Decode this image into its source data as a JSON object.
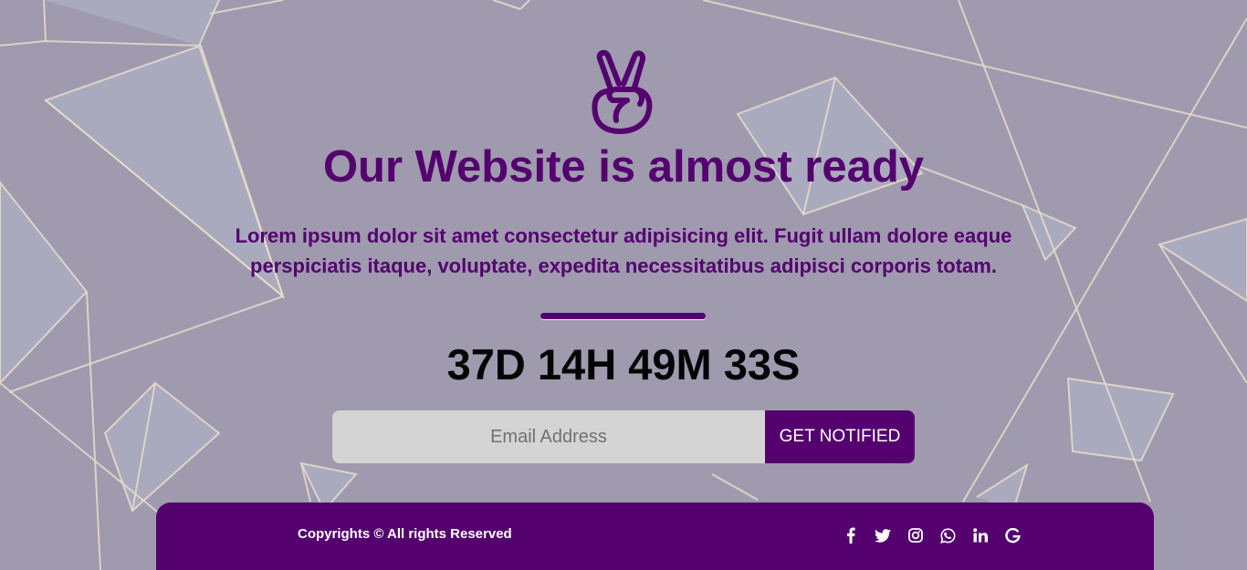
{
  "hero": {
    "title": "Our Website is almost ready",
    "subtitle": "Lorem ipsum dolor sit amet consectetur adipisicing elit. Fugit ullam dolore eaque perspiciatis itaque, voluptate, expedita necessitatibus adipisci corporis totam.",
    "logo_icon": "peace-hand-icon"
  },
  "countdown": {
    "days": "37D",
    "hours": "14H",
    "minutes": "49M",
    "seconds": "33S"
  },
  "subscribe": {
    "placeholder": "Email Address",
    "value": "",
    "button_label": "GET NOTIFIED"
  },
  "footer": {
    "copyright": "Copyrights © All rights Reserved",
    "social_icons": [
      "facebook-icon",
      "twitter-icon",
      "instagram-icon",
      "whatsapp-icon",
      "linkedin-icon",
      "google-icon"
    ]
  },
  "colors": {
    "accent": "#54006f",
    "background": "#9e99ad",
    "input_bg": "#d4d4d4",
    "text_dark": "#050505"
  }
}
